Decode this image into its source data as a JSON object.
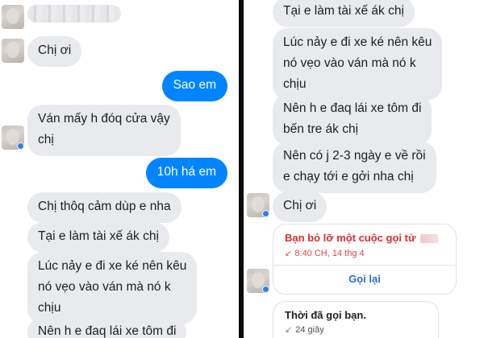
{
  "left_panel": {
    "messages": [
      {
        "id": "l1",
        "text": "Chị ơi"
      },
      {
        "id": "l2",
        "text": "Sao em"
      },
      {
        "id": "l3",
        "text": "Ván mấy h đóq cửa vậy\nchị"
      },
      {
        "id": "l4",
        "text": "10h há em"
      },
      {
        "id": "l5",
        "text": "Chị thôq cảm dùp e nha"
      },
      {
        "id": "l6",
        "text": "Tại e làm tài xế ák chị"
      },
      {
        "id": "l7",
        "text": "Lúc nảy e đi xe ké nên kêu\nnó vẹo vào ván mà nó k\nchịu"
      },
      {
        "id": "l8",
        "text": "Nên h e đaq lái xe tôm đi"
      }
    ]
  },
  "right_panel": {
    "messages": [
      {
        "id": "r1",
        "text": "Tại e làm tài xế ák chị"
      },
      {
        "id": "r2",
        "text": "Lúc nảy e đi xe ké nên kêu\nnó vẹo vào ván mà nó k\nchịu"
      },
      {
        "id": "r3",
        "text": "Nên h e đaq lái xe tôm đi\nbến tre ák chị"
      },
      {
        "id": "r4",
        "text": "Nên có j 2-3 ngày e về rồi\ne chạy tới e gởi nha chị"
      },
      {
        "id": "r5",
        "text": "Chị ơi"
      }
    ],
    "missed_call": {
      "title": "Bạn bỏ lỡ một cuộc gọi từ",
      "time_icon": "missed-call-arrow-icon",
      "time": "8:40 CH, 14 thg 4",
      "action": "Gọi lại"
    },
    "call_duration": {
      "title": "Thời đã gọi bạn.",
      "icon": "outgoing-call-arrow-icon",
      "value": "24 giây"
    }
  },
  "colors": {
    "incoming_bubble": "#e9eaed",
    "outgoing_bubble": "#0084ff",
    "missed_call": "#e02a2a",
    "link": "#2b6fc7"
  }
}
